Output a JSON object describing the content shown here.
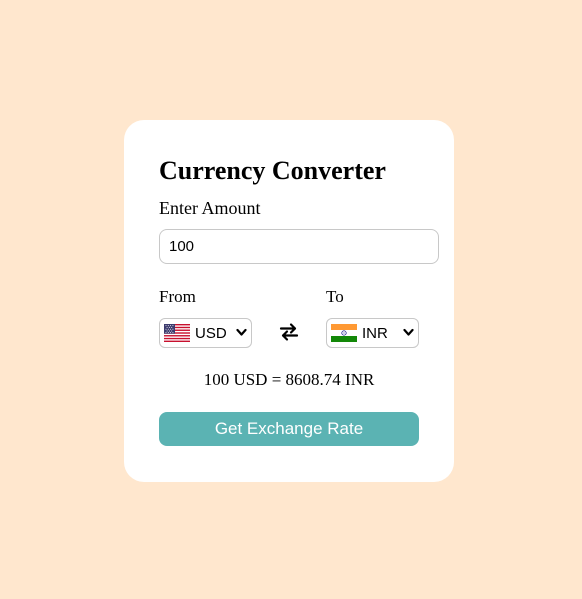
{
  "converter": {
    "title": "Currency Converter",
    "amount_label": "Enter Amount",
    "amount_value": "100",
    "from_label": "From",
    "to_label": "To",
    "from_currency": {
      "code": "USD",
      "flag_icon": "us-flag-icon"
    },
    "to_currency": {
      "code": "INR",
      "flag_icon": "india-flag-icon"
    },
    "result_text": "100 USD = 8608.74 INR",
    "button_label": "Get Exchange Rate"
  },
  "colors": {
    "page_background": "#ffe7ce",
    "card_background": "#ffffff",
    "button_background": "#5bb3b3",
    "button_text": "#ffffff"
  }
}
